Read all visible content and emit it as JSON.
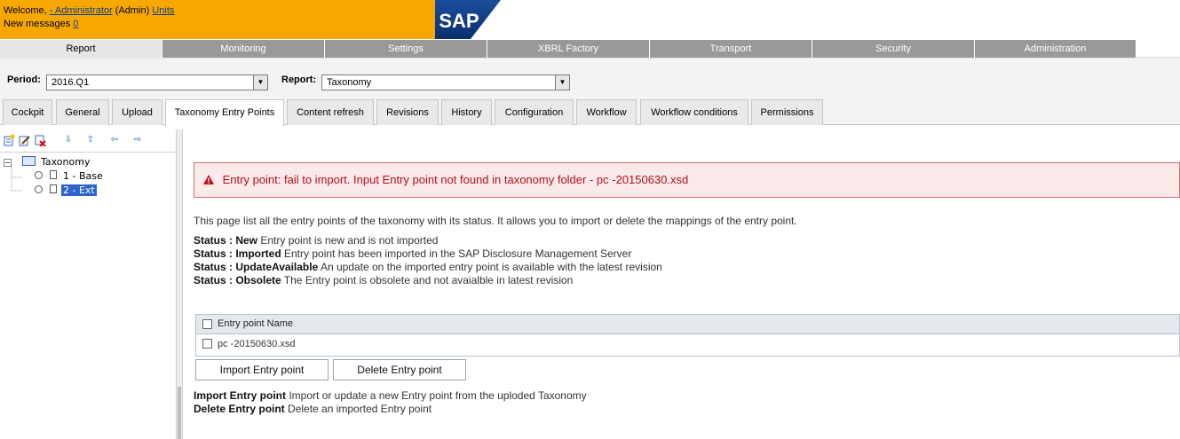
{
  "header": {
    "welcome_prefix": "Welcome,",
    "user_link": "- Administrator",
    "role": "(Admin)",
    "units_link": "Units",
    "messages_label": "New messages",
    "messages_count": "0",
    "logo_text": "SAP"
  },
  "mainnav": [
    "Report",
    "Monitoring",
    "Settings",
    "XBRL Factory",
    "Transport",
    "Security",
    "Administration"
  ],
  "filters": {
    "period_label": "Period:",
    "period_value": "2016.Q1",
    "report_label": "Report:",
    "report_value": "Taxonomy"
  },
  "subtabs": [
    "Cockpit",
    "General",
    "Upload",
    "Taxonomy Entry Points",
    "Content refresh",
    "Revisions",
    "History",
    "Configuration",
    "Workflow",
    "Workflow conditions",
    "Permissions"
  ],
  "tree": {
    "root": "Taxonomy",
    "children": [
      "1 - Base",
      "2 - Ext"
    ]
  },
  "content": {
    "error": "Entry point: fail to import. Input Entry point not found in taxonomy folder - pc  -20150630.xsd",
    "description": "This page list all the entry points of the taxonomy with its status. It allows you to import or delete the mappings of the entry point.",
    "statuses": [
      {
        "label": "Status : New",
        "text": " Entry point is new and is not imported"
      },
      {
        "label": "Status : Imported",
        "text": " Entry point has been imported in the SAP Disclosure Management Server"
      },
      {
        "label": "Status : UpdateAvailable",
        "text": " An update on the imported entry point is available with the latest revision"
      },
      {
        "label": "Status : Obsolete",
        "text": " The Entry point is obsolete and not avaialble in latest revision"
      }
    ],
    "table_header": "Entry point Name",
    "rows": [
      "pc  -20150630.xsd"
    ],
    "import_button": "Import Entry point",
    "delete_button": "Delete Entry point",
    "help": [
      {
        "label": "Import Entry point",
        "text": " Import or update a new Entry point from the uploded Taxonomy"
      },
      {
        "label": "Delete Entry point",
        "text": " Delete an imported Entry point"
      }
    ]
  },
  "colors": {
    "header_orange": "#f7a800",
    "nav_gray": "#999999",
    "error_red": "#b0101a",
    "selection_blue": "#2d63c8"
  }
}
